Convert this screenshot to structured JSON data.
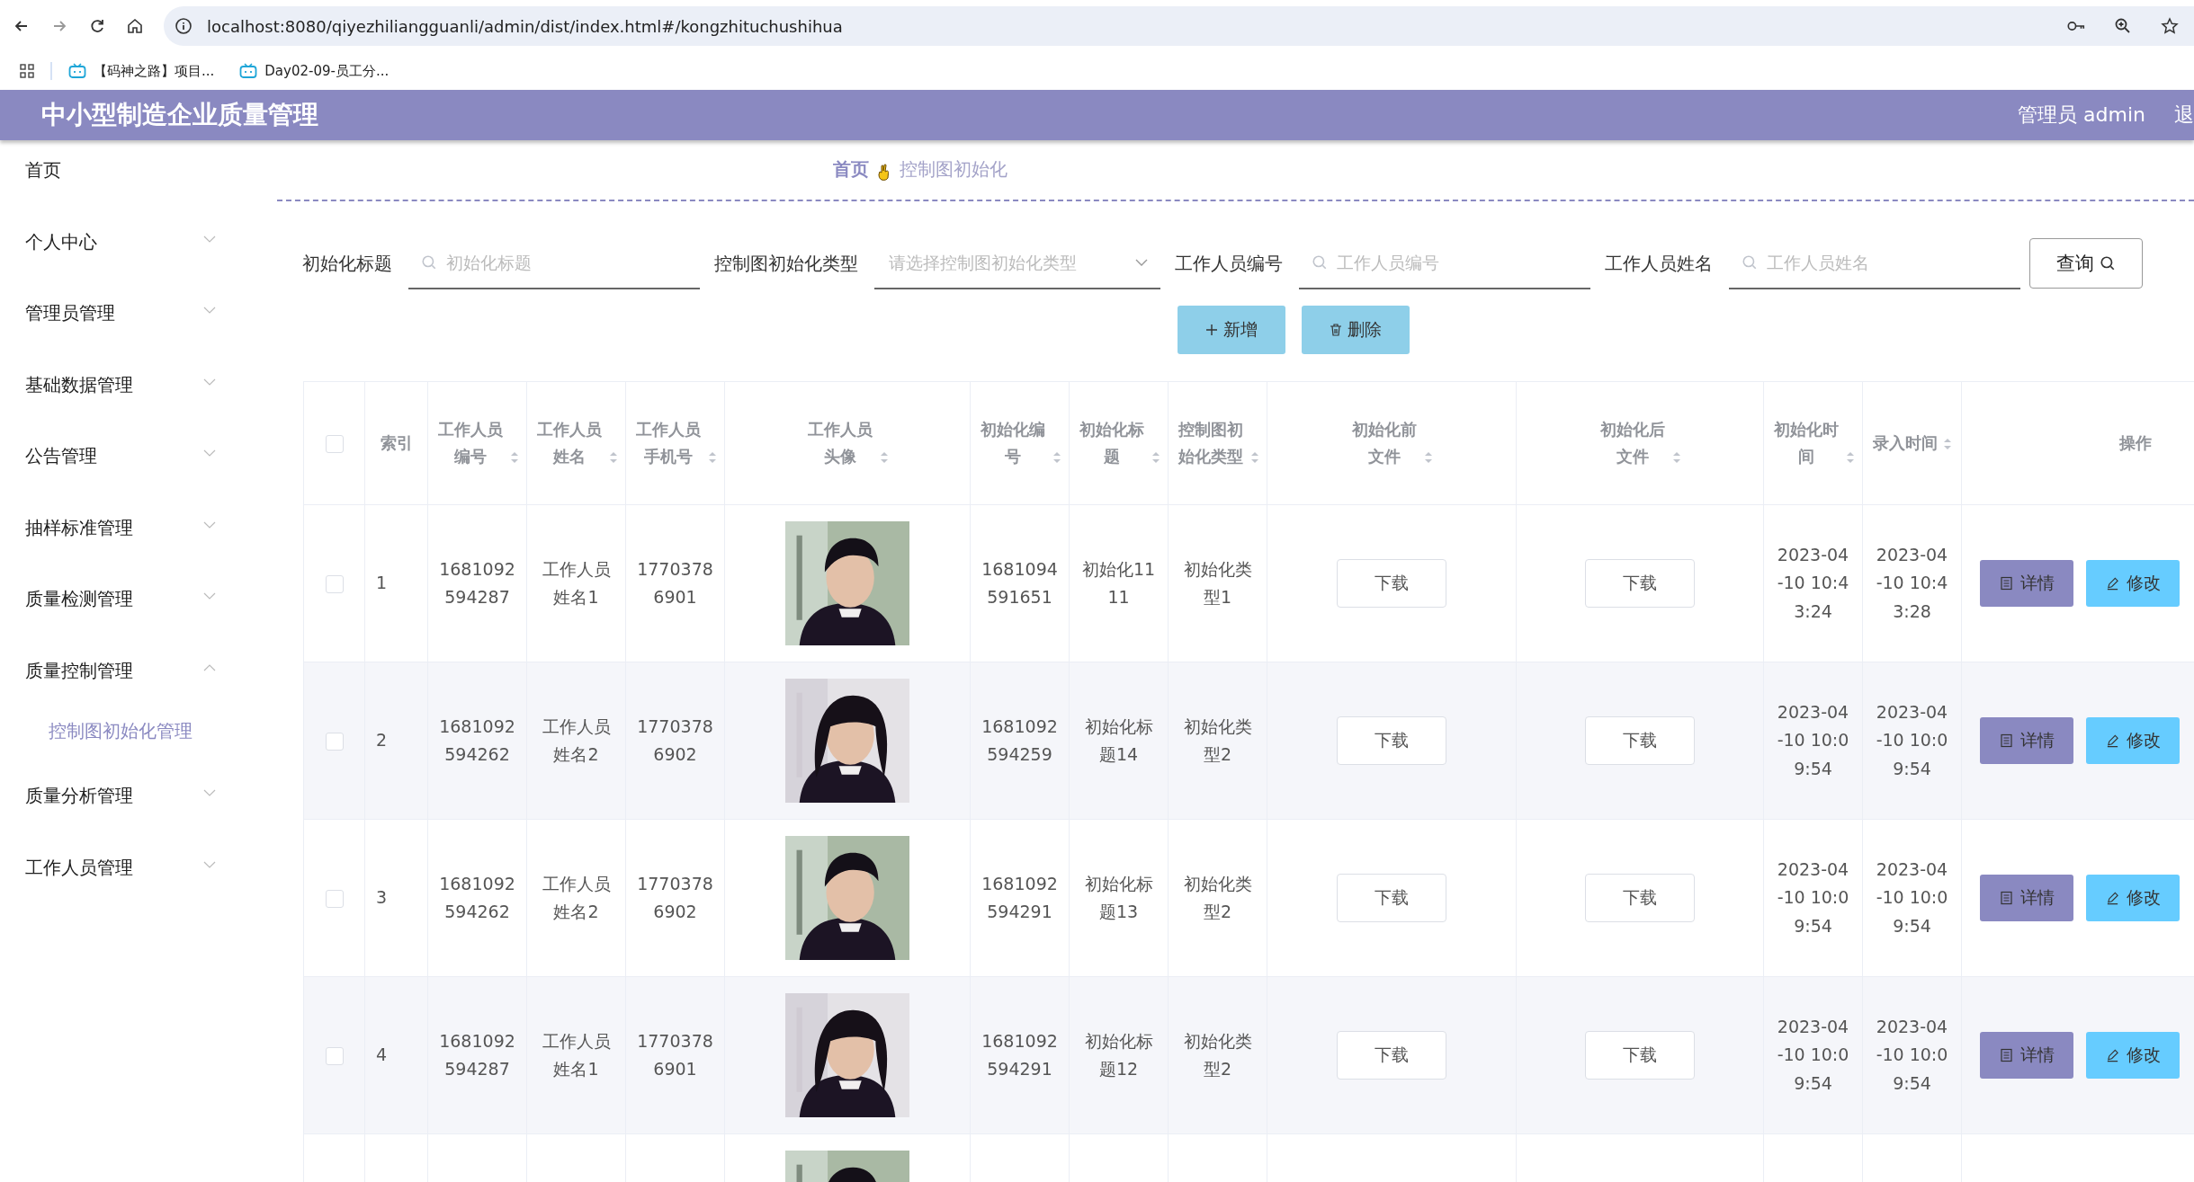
{
  "browser": {
    "url": "localhost:8080/qiyezhiliangguanli/admin/dist/index.html#/kongzhituchushihua",
    "bookmarks": [
      "【码神之路】项目...",
      "Day02-09-员工分..."
    ]
  },
  "header": {
    "title": "中小型制造企业质量管理",
    "user": "管理员 admin",
    "logout": "退"
  },
  "sidebar": {
    "items": [
      {
        "label": "首页"
      },
      {
        "label": "个人中心",
        "expanded": false
      },
      {
        "label": "管理员管理",
        "expanded": false
      },
      {
        "label": "基础数据管理",
        "expanded": false
      },
      {
        "label": "公告管理",
        "expanded": false
      },
      {
        "label": "抽样标准管理",
        "expanded": false
      },
      {
        "label": "质量检测管理",
        "expanded": false
      },
      {
        "label": "质量控制管理",
        "expanded": true,
        "children": [
          {
            "label": "控制图初始化管理",
            "selected": true
          }
        ]
      },
      {
        "label": "质量分析管理",
        "expanded": false
      },
      {
        "label": "工作人员管理",
        "expanded": false
      }
    ]
  },
  "breadcrumb": {
    "home": "首页",
    "current": "控制图初始化"
  },
  "filters": [
    {
      "kind": "search",
      "label": "初始化标题",
      "placeholder": "初始化标题"
    },
    {
      "kind": "select",
      "label": "控制图初始化类型",
      "placeholder": "请选择控制图初始化类型"
    },
    {
      "kind": "search",
      "label": "工作人员编号",
      "placeholder": "工作人员编号"
    },
    {
      "kind": "search",
      "label": "工作人员姓名",
      "placeholder": "工作人员姓名"
    }
  ],
  "query_button": "查询",
  "toolbar": [
    {
      "kind": "add",
      "label": "新增"
    },
    {
      "kind": "delete",
      "label": "删除"
    }
  ],
  "table": {
    "select_all_checked": false,
    "columns": [
      {
        "label": "索引",
        "sortable": false
      },
      {
        "label": "工作人员编号",
        "sortable": true
      },
      {
        "label": "工作人员姓名",
        "sortable": true
      },
      {
        "label": "工作人员手机号",
        "sortable": true
      },
      {
        "label": "工作人员头像",
        "sortable": true
      },
      {
        "label": "初始化编号",
        "sortable": true
      },
      {
        "label": "初始化标题",
        "sortable": true
      },
      {
        "label": "控制图初始化类型",
        "sortable": true
      },
      {
        "label": "初始化前文件",
        "sortable": true
      },
      {
        "label": "初始化后文件",
        "sortable": true
      },
      {
        "label": "初始化时间",
        "sortable": true
      },
      {
        "label": "录入时间",
        "sortable": true
      },
      {
        "label": "操作",
        "sortable": false
      }
    ],
    "rows": [
      {
        "checked": false,
        "index": "1",
        "staff_no": "1681092594287",
        "staff_name": "工作人员姓名1",
        "phone": "17703786901",
        "avatar": {
          "kind": "picture"
        },
        "init_no": "1681094591651",
        "title": "初始化1111",
        "type": "初始化类型1",
        "before_file": "下载",
        "after_file": "下载",
        "init_time": "2023-04-10 10:43:24",
        "created": "2023-04-10 10:43:28",
        "actions": [
          {
            "kind": "detail",
            "label": "详情"
          },
          {
            "kind": "edit",
            "label": "修改"
          }
        ]
      },
      {
        "checked": false,
        "index": "2",
        "staff_no": "1681092594262",
        "staff_name": "工作人员姓名2",
        "phone": "17703786902",
        "avatar": {
          "kind": "picture"
        },
        "init_no": "1681092594259",
        "title": "初始化标题14",
        "type": "初始化类型2",
        "before_file": "下载",
        "after_file": "下载",
        "init_time": "2023-04-10 10:09:54",
        "created": "2023-04-10 10:09:54",
        "actions": [
          {
            "kind": "detail",
            "label": "详情"
          },
          {
            "kind": "edit",
            "label": "修改"
          }
        ]
      },
      {
        "checked": false,
        "index": "3",
        "staff_no": "1681092594262",
        "staff_name": "工作人员姓名2",
        "phone": "17703786902",
        "avatar": {
          "kind": "picture"
        },
        "init_no": "1681092594291",
        "title": "初始化标题13",
        "type": "初始化类型2",
        "before_file": "下载",
        "after_file": "下载",
        "init_time": "2023-04-10 10:09:54",
        "created": "2023-04-10 10:09:54",
        "actions": [
          {
            "kind": "detail",
            "label": "详情"
          },
          {
            "kind": "edit",
            "label": "修改"
          }
        ]
      },
      {
        "checked": false,
        "index": "4",
        "staff_no": "1681092594287",
        "staff_name": "工作人员姓名1",
        "phone": "17703786901",
        "avatar": {
          "kind": "picture"
        },
        "init_no": "1681092594291",
        "title": "初始化标题12",
        "type": "初始化类型2",
        "before_file": "下载",
        "after_file": "下载",
        "init_time": "2023-04-10 10:09:54",
        "created": "2023-04-10 10:09:54",
        "actions": [
          {
            "kind": "detail",
            "label": "详情"
          },
          {
            "kind": "edit",
            "label": "修改"
          }
        ]
      },
      {
        "avatar": {
          "kind": "picture"
        }
      }
    ]
  }
}
